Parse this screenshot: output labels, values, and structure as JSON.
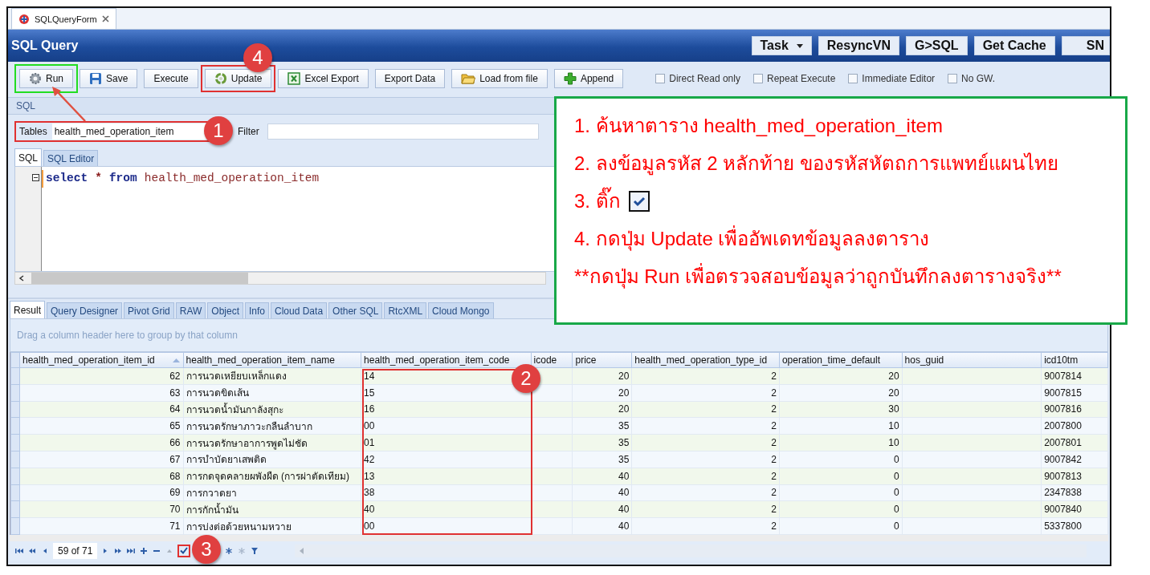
{
  "doc_tab": {
    "title": "SQLQueryForm"
  },
  "header": {
    "title": "SQL Query",
    "buttons": [
      {
        "label": "Task",
        "kind": "dropdown"
      },
      {
        "label": "ResyncVN",
        "kind": "plain"
      },
      {
        "label": "G>SQL",
        "kind": "plain"
      },
      {
        "label": "Get Cache",
        "kind": "plain"
      },
      {
        "label": "SN",
        "kind": "plain"
      }
    ]
  },
  "toolbar": {
    "buttons": [
      {
        "label": "Run"
      },
      {
        "label": "Save"
      },
      {
        "label": "Execute"
      },
      {
        "label": "Update"
      },
      {
        "label": "Excel Export"
      },
      {
        "label": "Export Data"
      },
      {
        "label": "Load from file"
      },
      {
        "label": "Append"
      }
    ],
    "options": [
      {
        "label": "Direct Read only",
        "checked": false
      },
      {
        "label": "Repeat Execute",
        "checked": false
      },
      {
        "label": "Immediate Editor",
        "checked": false
      },
      {
        "label": "No GW.",
        "checked": false
      }
    ]
  },
  "sql": {
    "title": "SQL",
    "tables_label": "Tables",
    "tables_value": "health_med_operation_item",
    "filter_label": "Filter",
    "tabs": [
      {
        "label": "SQL",
        "selected": true
      },
      {
        "label": "SQL Editor",
        "selected": false
      }
    ],
    "query": [
      {
        "text": "select",
        "kind": "keyword"
      },
      {
        "text": "*",
        "kind": "operator"
      },
      {
        "text": "from",
        "kind": "keyword"
      },
      {
        "text": "health_med_operation_item",
        "kind": "identifier"
      }
    ]
  },
  "result": {
    "tabs": [
      {
        "label": "Result",
        "selected": true
      },
      {
        "label": "Query Designer",
        "selected": false
      },
      {
        "label": "Pivot Grid",
        "selected": false
      },
      {
        "label": "RAW",
        "selected": false
      },
      {
        "label": "Object",
        "selected": false
      },
      {
        "label": "Info",
        "selected": false
      },
      {
        "label": "Cloud Data",
        "selected": false
      },
      {
        "label": "Other SQL",
        "selected": false
      },
      {
        "label": "RtcXML",
        "selected": false
      },
      {
        "label": "Cloud Mongo",
        "selected": false
      }
    ],
    "group_hint": "Drag a column header here to group by that column",
    "table": {
      "columns": [
        {
          "label": "health_med_operation_item_id",
          "sorted": true
        },
        {
          "label": "health_med_operation_item_name",
          "sorted": false
        },
        {
          "label": "health_med_operation_item_code",
          "sorted": false
        },
        {
          "label": "icode",
          "sorted": false
        },
        {
          "label": "price",
          "sorted": false
        },
        {
          "label": "health_med_operation_type_id",
          "sorted": false
        },
        {
          "label": "operation_time_default",
          "sorted": false
        },
        {
          "label": "hos_guid",
          "sorted": false
        },
        {
          "label": "icd10tm",
          "sorted": false
        }
      ],
      "rows": [
        [
          "62",
          "การนวดเหยียบเหล็กแดง",
          "14",
          null,
          "20",
          "2",
          "20",
          null,
          "9007814"
        ],
        [
          "63",
          "การนวดขิดเส้น",
          "15",
          null,
          "20",
          "2",
          "20",
          null,
          "9007815"
        ],
        [
          "64",
          "การนวดน้ำมันกาลังสุกะ",
          "16",
          null,
          "20",
          "2",
          "30",
          null,
          "9007816"
        ],
        [
          "65",
          "การนวดรักษาภาวะกลืนลำบาก",
          "00",
          null,
          "35",
          "2",
          "10",
          null,
          "2007800"
        ],
        [
          "66",
          "การนวดรักษาอาการพูดไม่ชัด",
          "01",
          null,
          "35",
          "2",
          "10",
          null,
          "2007801"
        ],
        [
          "67",
          "การบำบัดยาเสพติด",
          "42",
          null,
          "35",
          "2",
          "0",
          null,
          "9007842"
        ],
        [
          "68",
          "การกดจุดคลายผพังผืด (การผ่าตัดเทียม)",
          "13",
          null,
          "40",
          "2",
          "0",
          null,
          "9007813"
        ],
        [
          "69",
          "การกวาดยา",
          "38",
          null,
          "40",
          "2",
          "0",
          null,
          "2347838"
        ],
        [
          "70",
          "การกักน้ำมัน",
          "40",
          null,
          "40",
          "2",
          "0",
          null,
          "9007840"
        ],
        [
          "71",
          "การบ่งต่อด้วยหนามหวาย",
          "00",
          null,
          "40",
          "2",
          "0",
          null,
          "5337800"
        ]
      ]
    },
    "navigator": {
      "position": "59 of 71"
    }
  },
  "callout": {
    "lines": [
      {
        "kind": "text",
        "text": "1. ค้นหาตาราง health_med_operation_item"
      },
      {
        "kind": "text",
        "text": "2. ลงข้อมูลรหัส 2 หลักท้าย ของรหัสหัตถการแพทย์แผนไทย"
      },
      {
        "kind": "checkbox",
        "text": "3. ติ๊ก"
      },
      {
        "kind": "text",
        "text": "4. กดปุ่ม Update เพื่ออัพเดทข้อมูลลงตาราง"
      },
      {
        "kind": "text",
        "text": "**กดปุ่ม Run เพื่อตรวจสอบข้อมูลว่าถูกบันทึกลงตารางจริง**"
      }
    ]
  },
  "badges": [
    {
      "number": "1"
    },
    {
      "number": "2"
    },
    {
      "number": "3"
    },
    {
      "number": "4"
    }
  ]
}
